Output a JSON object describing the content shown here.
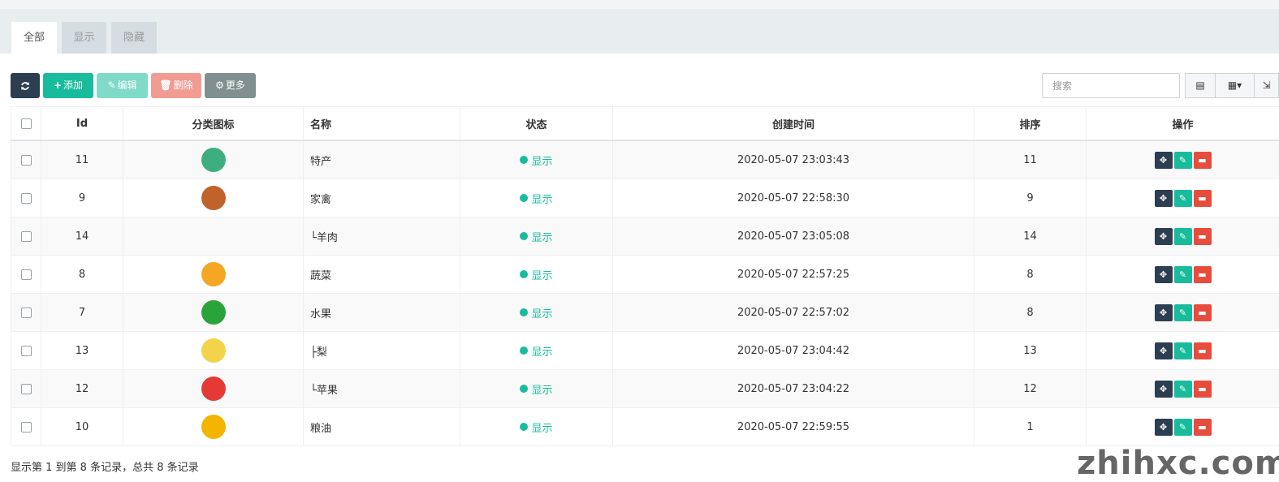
{
  "tabs": [
    "全部",
    "显示",
    "隐藏"
  ],
  "toolbar": {
    "refresh_icon": "refresh-icon",
    "add_label": "添加",
    "edit_label": "编辑",
    "delete_label": "删除",
    "more_label": "更多",
    "search_placeholder": "搜索"
  },
  "table": {
    "headers": [
      "Id",
      "分类图标",
      "名称",
      "状态",
      "创建时间",
      "排序",
      "操作"
    ],
    "rows": [
      {
        "id": "11",
        "icon": "specialty-icon",
        "icon_color": "#3fae7f",
        "name": "特产",
        "status": "显示",
        "created": "2020-05-07 23:03:43",
        "sort": "11"
      },
      {
        "id": "9",
        "icon": "chicken-icon",
        "icon_color": "#c0632a",
        "name": "家禽",
        "status": "显示",
        "created": "2020-05-07 22:58:30",
        "sort": "9"
      },
      {
        "id": "14",
        "icon": "",
        "icon_color": "",
        "name": "└羊肉",
        "status": "显示",
        "created": "2020-05-07 23:05:08",
        "sort": "14"
      },
      {
        "id": "8",
        "icon": "vegetable-icon",
        "icon_color": "#f5a623",
        "name": "蔬菜",
        "status": "显示",
        "created": "2020-05-07 22:57:25",
        "sort": "8"
      },
      {
        "id": "7",
        "icon": "fruit-icon",
        "icon_color": "#2aa33a",
        "name": "水果",
        "status": "显示",
        "created": "2020-05-07 22:57:02",
        "sort": "8"
      },
      {
        "id": "13",
        "icon": "pear-icon",
        "icon_color": "#f3d34a",
        "name": "├梨",
        "status": "显示",
        "created": "2020-05-07 23:04:42",
        "sort": "13"
      },
      {
        "id": "12",
        "icon": "apple-icon",
        "icon_color": "#e53935",
        "name": "└苹果",
        "status": "显示",
        "created": "2020-05-07 23:04:22",
        "sort": "12"
      },
      {
        "id": "10",
        "icon": "grain-oil-icon",
        "icon_color": "#f4b400",
        "name": "粮油",
        "status": "显示",
        "created": "2020-05-07 22:59:55",
        "sort": "1"
      }
    ]
  },
  "footer": "显示第 1 到第 8 条记录，总共 8 条记录",
  "watermark": "zhihxc.com"
}
